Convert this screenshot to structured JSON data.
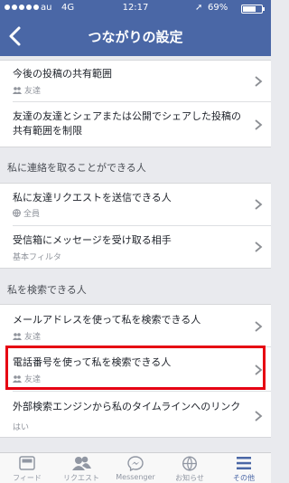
{
  "status_bar": {
    "carrier": "au",
    "network": "4G",
    "time": "12:17",
    "battery": "69%",
    "battery_level": 0.69
  },
  "header": {
    "title": "つながりの設定"
  },
  "groups": [
    {
      "rows": [
        {
          "label": "今後の投稿の共有範囲",
          "value": "友達",
          "icon": "friends-icon"
        },
        {
          "label": "友達の友達とシェアまたは公開でシェアした投稿の共有範囲を制限"
        }
      ]
    },
    {
      "section": "私に連絡を取ることができる人",
      "rows": [
        {
          "label": "私に友達リクエストを送信できる人",
          "value": "全員",
          "icon": "globe-icon"
        },
        {
          "label": "受信箱にメッセージを受け取る相手",
          "value": "基本フィルタ"
        }
      ]
    },
    {
      "section": "私を検索できる人",
      "rows": [
        {
          "label": "メールアドレスを使って私を検索できる人",
          "value": "友達",
          "icon": "friends-icon"
        },
        {
          "label": "電話番号を使って私を検索できる人",
          "value": "友達",
          "icon": "friends-icon"
        },
        {
          "label": "外部検索エンジンから私のタイムラインへのリンク",
          "value": "はい"
        }
      ]
    }
  ],
  "tabbar": [
    {
      "label": "フィード",
      "icon": "feed-icon",
      "active": false
    },
    {
      "label": "リクエスト",
      "icon": "requests-icon",
      "active": false
    },
    {
      "label": "Messenger",
      "icon": "messenger-icon",
      "active": false
    },
    {
      "label": "お知らせ",
      "icon": "globe-icon",
      "active": false
    },
    {
      "label": "その他",
      "icon": "menu-icon",
      "active": true
    }
  ],
  "colors": {
    "header": "#4a67a6",
    "highlight": "#e60012",
    "background": "#e9eaee"
  }
}
